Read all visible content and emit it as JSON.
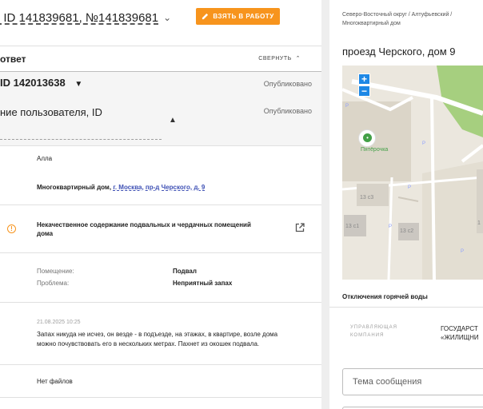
{
  "ticket": {
    "ids": ", ID 141839681, №141839681",
    "take_button": "ВЗЯТЬ В РАБОТУ"
  },
  "answer": {
    "title": "ответ",
    "collapse_label": "СВЕРНУТЬ",
    "id_row": "ID 142013638",
    "id_status": "Опубликовано",
    "user_row": "ние пользователя, ID",
    "user_status": "Опубликовано"
  },
  "details": {
    "author": "Алла",
    "location_prefix": "Многоквартирный дом,",
    "location_link": "г. Москва, пр-д Черского, д. 9",
    "problem_title_line1": "Некачественное содержание подвальных и чердачных помещений",
    "problem_title_line2": "дома",
    "room_label": "Помещение:",
    "room_value": "Подвал",
    "problem_label": "Проблема:",
    "problem_value": "Неприятный запах",
    "message_date": "21.08.2025 10:25",
    "message_line1": "Запах никуда не исчез, он везде - в подъезде, на этажах, в квартире, возле дома",
    "message_line2": "можно почувствовать его в нескольких метрах. Пахнет из окошек подвала.",
    "files": "Нет файлов"
  },
  "address": {
    "crumb_line1": "Северо-Восточный округ / Алтуфьевский /",
    "crumb_line2": "Многоквартирный дом",
    "title": "проезд Черского, дом 9"
  },
  "map": {
    "zoom_in": "+",
    "zoom_out": "−",
    "poi_store": "Пятёрочка",
    "bld1": "13 с3",
    "bld2": "13 с1",
    "bld3": "13 с2",
    "bld4": "1",
    "poi_p": "P"
  },
  "outages": {
    "title": "Отключения горячей воды",
    "company_label_1": "УПРАВЛЯЮЩАЯ",
    "company_label_2": "КОМПАНИЯ",
    "company_value_1": "ГОСУДАРСТ",
    "company_value_2": "«ЖИЛИЩНИ"
  },
  "form": {
    "subject_placeholder": "Тема сообщения"
  },
  "colors": {
    "accent_orange": "#f7941d",
    "link_blue": "#3f51b5",
    "map_blue": "#1e88e5"
  }
}
